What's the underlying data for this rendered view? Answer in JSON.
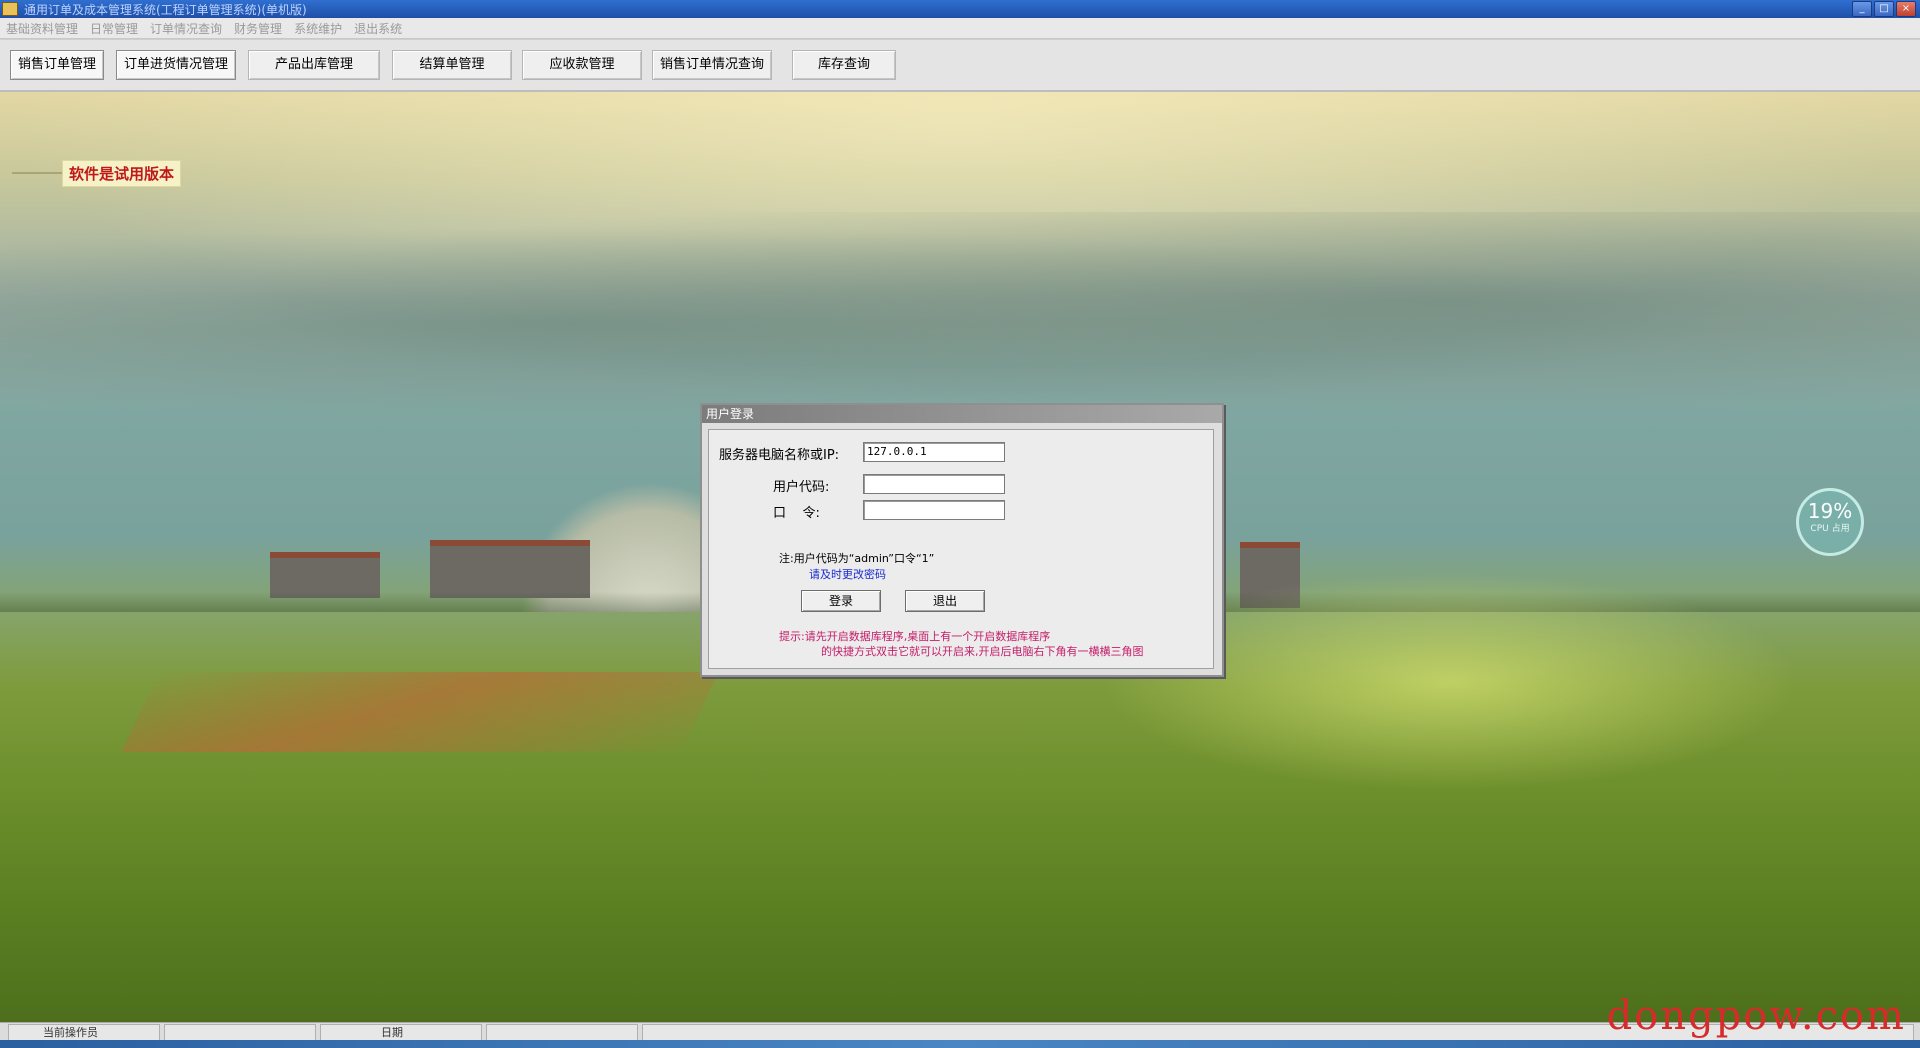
{
  "window": {
    "title": "通用订单及成本管理系统(工程订单管理系统)(单机版)",
    "controls": [
      "_",
      "□",
      "×"
    ]
  },
  "menu": [
    "基础资料管理",
    "日常管理",
    "订单情况查询",
    "财务管理",
    "系统维护",
    "退出系统"
  ],
  "toolbar": [
    {
      "label": "销售订单管理",
      "active": true
    },
    {
      "label": "订单进货情况管理",
      "active": true
    },
    {
      "label": "产品出库管理",
      "active": false
    },
    {
      "label": "结算单管理",
      "active": false
    },
    {
      "label": "应收款管理",
      "active": false
    },
    {
      "label": "销售订单情况查询",
      "active": false
    },
    {
      "label": "库存查询",
      "active": false
    }
  ],
  "trial_notice": "软件是试用版本",
  "cpu_meter": {
    "value": "19%",
    "label": "CPU 占用"
  },
  "login_dialog": {
    "title": "用户登录",
    "server_label": "服务器电脑名称或IP:",
    "server_value": "127.0.0.1",
    "user_label": "用户代码:",
    "user_value": "",
    "password_label": "口    令:",
    "password_value": "",
    "note_line1": "注:用户代码为“admin”口令“1”",
    "note_line2": "请及时更改密码",
    "login_button": "登录",
    "exit_button": "退出",
    "hint_line1": "提示:请先开启数据库程序,桌面上有一个开启数据库程序",
    "hint_line2": "的快捷方式双击它就可以开启来,开启后电脑右下角有一横横三角图"
  },
  "status_bar": {
    "current_label": "当前操作员",
    "current_value": "",
    "date_label": "日期",
    "date_value": ""
  },
  "watermark": "dongpow.com"
}
